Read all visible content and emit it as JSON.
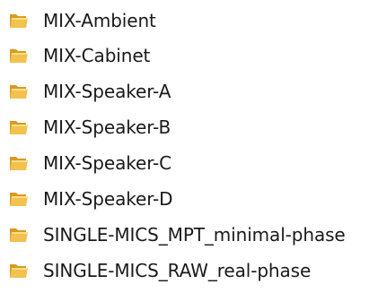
{
  "folder_list": {
    "items": [
      {
        "label": "MIX-Ambient",
        "icon": "folder-icon"
      },
      {
        "label": "MIX-Cabinet",
        "icon": "folder-icon"
      },
      {
        "label": "MIX-Speaker-A",
        "icon": "folder-icon"
      },
      {
        "label": "MIX-Speaker-B",
        "icon": "folder-icon"
      },
      {
        "label": "MIX-Speaker-C",
        "icon": "folder-icon"
      },
      {
        "label": "MIX-Speaker-D",
        "icon": "folder-icon"
      },
      {
        "label": "SINGLE-MICS_MPT_minimal-phase",
        "icon": "folder-icon"
      },
      {
        "label": "SINGLE-MICS_RAW_real-phase",
        "icon": "folder-icon"
      }
    ]
  },
  "colors": {
    "folder_front": "#f2c14e",
    "folder_back": "#d99a22",
    "folder_highlight": "#fbe08a",
    "text": "#1a1a1a",
    "background": "#ffffff"
  }
}
